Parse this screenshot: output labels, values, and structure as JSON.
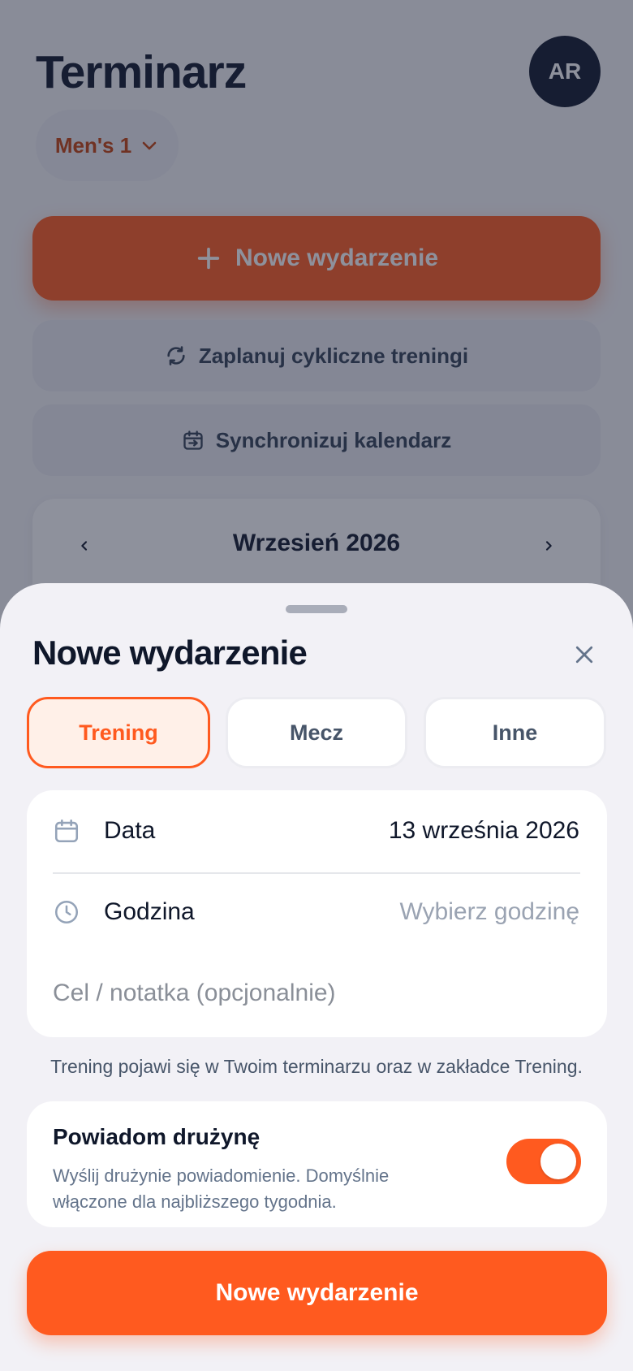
{
  "app": {
    "title": "Terminarz",
    "avatar_initials": "AR",
    "team_selector": {
      "label": "Men's 1",
      "icon": "chevron-down-icon"
    },
    "actions": {
      "new_event": {
        "label": "Nowe wydarzenie",
        "icon": "plus-icon"
      },
      "recurring": {
        "label": "Zaplanuj cykliczne treningi",
        "icon": "repeat-icon"
      },
      "sync": {
        "label": "Synchronizuj kalendarz",
        "icon": "calendar-sync-icon"
      }
    },
    "calendar": {
      "month_label": "Wrzesień 2026"
    }
  },
  "sheet": {
    "title": "Nowe wydarzenie",
    "types": [
      {
        "label": "Trening",
        "selected": true
      },
      {
        "label": "Mecz",
        "selected": false
      },
      {
        "label": "Inne",
        "selected": false
      }
    ],
    "fields": {
      "date": {
        "label": "Data",
        "value": "13 września 2026",
        "icon": "calendar-icon"
      },
      "time": {
        "label": "Godzina",
        "placeholder": "Wybierz godzinę",
        "icon": "clock-icon"
      },
      "note": {
        "placeholder": "Cel / notatka (opcjonalnie)",
        "value": ""
      }
    },
    "hint": "Trening pojawi się w Twoim terminarzu oraz w zakładce Trening.",
    "notify": {
      "title": "Powiadom drużynę",
      "description": "Wyślij drużynie powiadomienie. Domyślnie włączone dla najbliższego tygodnia.",
      "enabled": true
    },
    "submit_label": "Nowe wydarzenie"
  },
  "colors": {
    "accent": "#ff5a1f",
    "accent_soft": "#fff0e8",
    "dark": "#0f172a",
    "sheet_bg": "#f2f1f6"
  }
}
